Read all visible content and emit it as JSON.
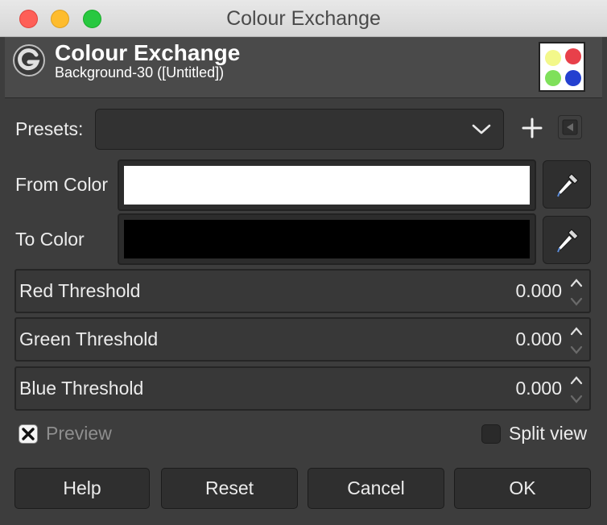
{
  "window": {
    "title": "Colour Exchange"
  },
  "header": {
    "title": "Colour Exchange",
    "subtitle": "Background-30 ([Untitled])",
    "logo_icon": "gimp-logo-icon"
  },
  "presets": {
    "label": "Presets:",
    "value": ""
  },
  "from_color": {
    "label": "From Color",
    "color": "#ffffff"
  },
  "to_color": {
    "label": "To Color",
    "color": "#000000"
  },
  "thresholds": [
    {
      "label": "Red Threshold",
      "value": "0.000"
    },
    {
      "label": "Green Threshold",
      "value": "0.000"
    },
    {
      "label": "Blue Threshold",
      "value": "0.000"
    }
  ],
  "preview": {
    "label": "Preview",
    "checked": true
  },
  "split_view": {
    "label": "Split view",
    "checked": false
  },
  "buttons": {
    "help": "Help",
    "reset": "Reset",
    "cancel": "Cancel",
    "ok": "OK"
  },
  "colors": {
    "background": "#3d3d3d",
    "thumb_yellow": "#f3f88a",
    "thumb_red": "#e8404a",
    "thumb_green": "#7fe05a",
    "thumb_blue": "#2440d0"
  }
}
